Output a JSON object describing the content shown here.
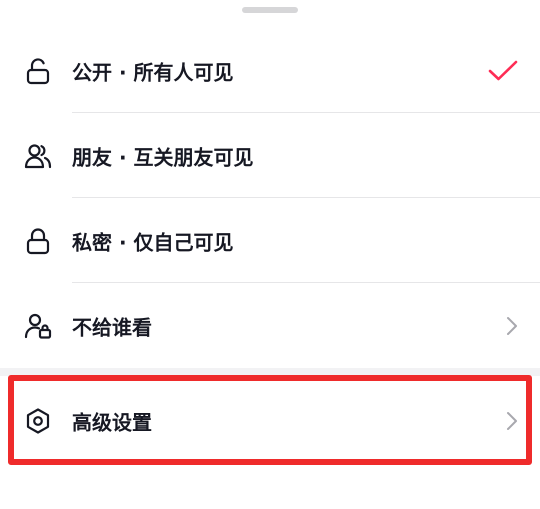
{
  "sheet": {
    "options": [
      {
        "label": "公开 · 所有人可见",
        "icon": "unlock-icon",
        "selected": true
      },
      {
        "label": "朋友 · 互关朋友可见",
        "icon": "friends-icon",
        "selected": false
      },
      {
        "label": "私密 · 仅自己可见",
        "icon": "lock-icon",
        "selected": false
      },
      {
        "label": "不给谁看",
        "icon": "user-lock-icon",
        "has_chevron": true
      }
    ],
    "advanced": {
      "label": "高级设置",
      "icon": "hexagon-settings-icon",
      "has_chevron": true
    }
  },
  "colors": {
    "check": "#fe2c55",
    "text": "#161823",
    "chevron": "#a8a8ae",
    "highlight": "#ef2b2b"
  }
}
